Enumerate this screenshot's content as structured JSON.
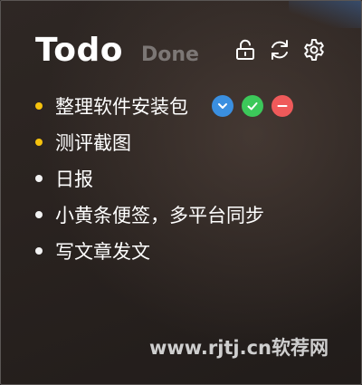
{
  "header": {
    "title": "Todo",
    "done_tab": "Done"
  },
  "toolbar": {
    "icons": [
      "unlock-icon",
      "sync-icon",
      "gear-icon"
    ]
  },
  "todos": [
    {
      "label": "整理软件安装包",
      "bullet_color": "#f5c20d",
      "selected": true
    },
    {
      "label": "测评截图",
      "bullet_color": "#f5c20d",
      "selected": false
    },
    {
      "label": "日报",
      "bullet_color": "#f2f2f2",
      "selected": false
    },
    {
      "label": "小黄条便签，多平台同步",
      "bullet_color": "#f2f2f2",
      "selected": false
    },
    {
      "label": "写文章发文",
      "bullet_color": "#f2f2f2",
      "selected": false
    }
  ],
  "item_actions": {
    "icons": [
      "chevron-down-icon",
      "check-icon",
      "minus-icon"
    ],
    "colors": {
      "expand": "#3a8fe0",
      "complete": "#3cc85a",
      "delete": "#ef5a5a"
    }
  },
  "watermark": "www.rjtj.cn软荐网"
}
